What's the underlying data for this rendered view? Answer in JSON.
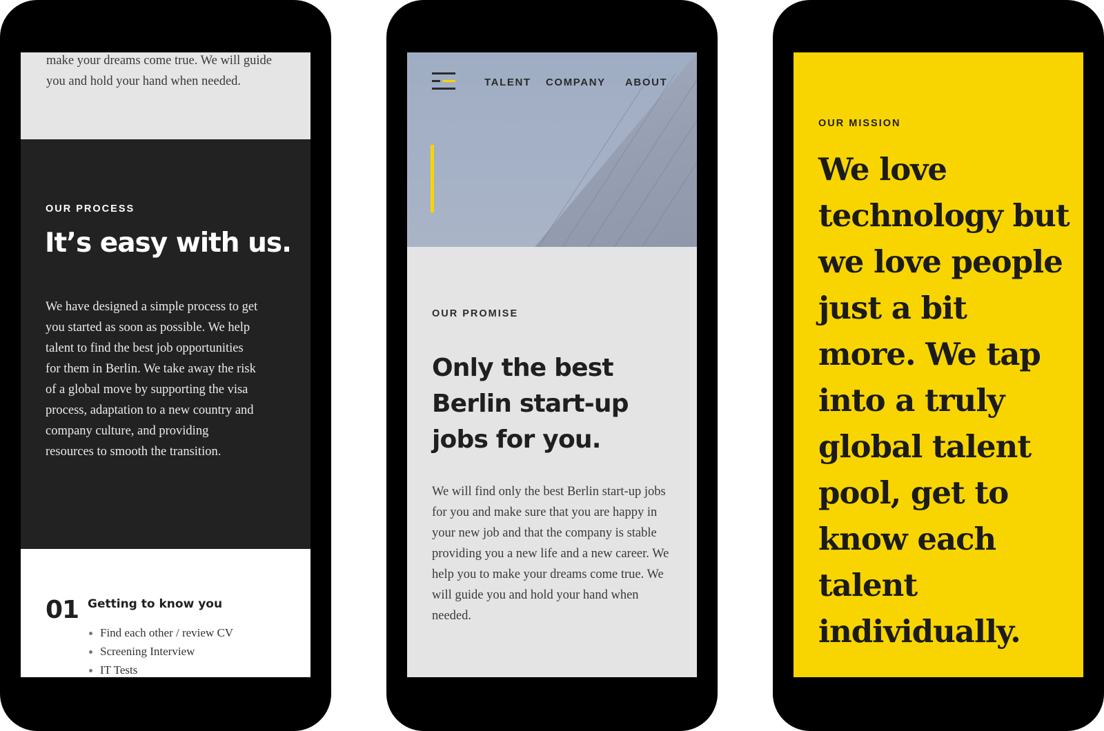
{
  "phone1": {
    "top_text": "make your dreams come true. We will guide you and hold your hand when needed.",
    "process": {
      "eyebrow": "OUR PROCESS",
      "heading": "It’s easy with us.",
      "body": "We have designed a simple process to get you started as soon as possible. We help talent to find the best job opportunities for them in Berlin. We take away the risk of a global move by supporting the visa process, adaptation to a new country and company culture, and providing resources to smooth the transition."
    },
    "step": {
      "number": "01",
      "title": "Getting to know you",
      "items": [
        "Find each other / review CV",
        "Screening Interview",
        "IT Tests"
      ]
    }
  },
  "phone2": {
    "nav": [
      "TALENT",
      "COMPANY",
      "ABOUT"
    ],
    "promise": {
      "eyebrow": "OUR PROMISE",
      "heading": "Only the best Berlin start-up jobs for you.",
      "body": "We will find only the best Berlin start-up jobs for you and make sure that you are happy in your new job and that the company is stable providing you a new life and a new career. We help you to make your dreams come true. We will guide you and hold your hand when needed."
    }
  },
  "phone3": {
    "mission": {
      "eyebrow": "OUR MISSION",
      "heading": "We love technology but we love people just a bit more. We tap into a truly global talent pool, get to know each talent individually."
    }
  },
  "colors": {
    "accent": "#f8d500",
    "dark_section": "#222222",
    "light_section": "#e4e4e4"
  },
  "icons": [
    "menu-icon"
  ]
}
